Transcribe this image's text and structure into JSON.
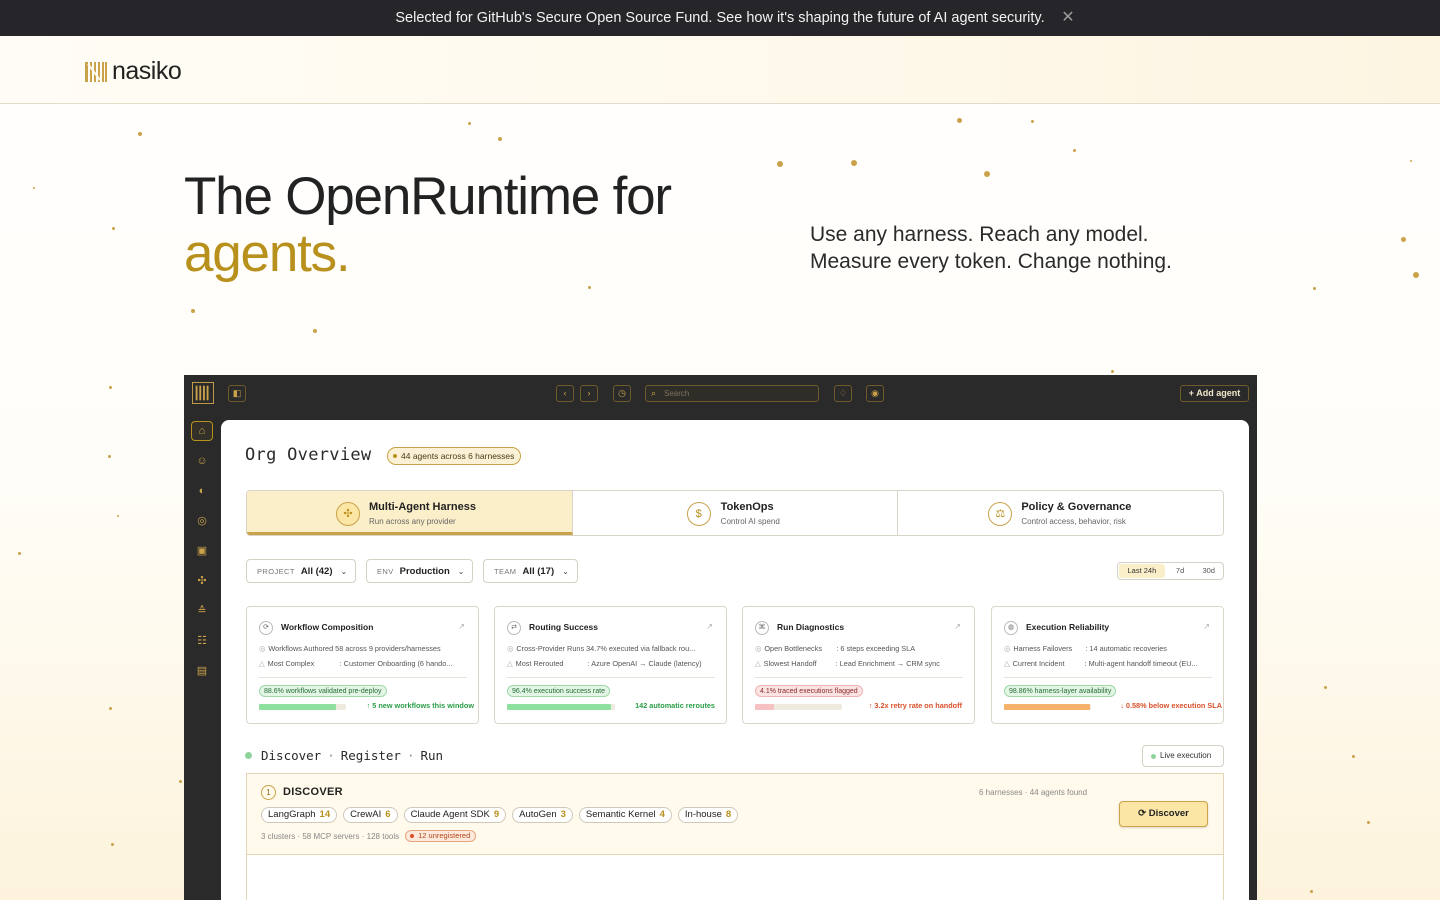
{
  "announcement": {
    "text": "Selected for GitHub's Secure Open Source Fund. See how it's shaping the future of AI agent security.",
    "close_icon": "close-icon"
  },
  "brand": {
    "name": "nasiko",
    "accent_color": "#c9a24a"
  },
  "hero": {
    "title_line1": "The OpenRuntime for",
    "title_line2": "agents.",
    "subtitle_line1": "Use any harness. Reach any model.",
    "subtitle_line2": "Measure every token. Change nothing."
  },
  "app": {
    "search_placeholder": "Search",
    "add_agent_label": "Add agent",
    "toolbar_icons": [
      "sidebar-toggle-icon",
      "back-icon",
      "forward-icon",
      "history-icon",
      "bell-icon",
      "settings-icon"
    ],
    "side_nav_icons": [
      "home-icon",
      "agent-icon",
      "brain-icon",
      "target-icon",
      "token-icon",
      "puzzle-icon",
      "stack-icon",
      "users-icon",
      "database-icon"
    ],
    "org_title": "Org Overview",
    "org_badge": "44 agents across 6 harnesses",
    "tabs": [
      {
        "title": "Multi-Agent Harness",
        "desc": "Run across any provider",
        "icon": "puzzle-icon",
        "active": true
      },
      {
        "title": "TokenOps",
        "desc": "Control AI spend",
        "icon": "token-icon",
        "active": false
      },
      {
        "title": "Policy & Governance",
        "desc": "Control access, behavior, risk",
        "icon": "scale-icon",
        "active": false
      }
    ],
    "filters": [
      {
        "key": "PROJECT",
        "value": "All (42)"
      },
      {
        "key": "ENV",
        "value": "Production"
      },
      {
        "key": "TEAM",
        "value": "All (17)"
      }
    ],
    "time_range": {
      "options": [
        "Last 24h",
        "7d",
        "30d"
      ],
      "selected": "Last 24h"
    },
    "cards": [
      {
        "title": "Workflow Composition",
        "row1_key": "Workflows Authored",
        "row1_val": "58 across 9 providers/harnesses",
        "row2_key": "Most Complex",
        "row2_val": ": Customer Onboarding (6 hando...",
        "pill": "88.6% workflows validated pre-deploy",
        "pill_kind": "green",
        "bar_fraction": 0.886,
        "bar_color": "#8ee0a0",
        "delta": "↑ 5 new workflows this window",
        "delta_kind": "up"
      },
      {
        "title": "Routing Success",
        "row1_key": "Cross-Provider Runs",
        "row1_val": "34.7% executed via fallback rou...",
        "row2_key": "Most Rerouted",
        "row2_val": ": Azure OpenAI → Claude (latency)",
        "pill": "96.4% execution success rate",
        "pill_kind": "green",
        "bar_fraction": 0.964,
        "bar_color": "#8ee0a0",
        "delta": "142 automatic reroutes",
        "delta_kind": "up"
      },
      {
        "title": "Run Diagnostics",
        "row1_key": "Open Bottlenecks",
        "row1_val": ": 6 steps exceeding SLA",
        "row2_key": "Slowest Handoff",
        "row2_val": ": Lead Enrichment → CRM sync",
        "pill": "4.1% traced executions flagged",
        "pill_kind": "red",
        "bar_fraction": 0.22,
        "bar_color": "#f6c1c1",
        "delta": "↑ 3.2x retry rate on handoff",
        "delta_kind": "down"
      },
      {
        "title": "Execution Reliability",
        "row1_key": "Harness Failovers",
        "row1_val": ": 14 automatic recoveries",
        "row2_key": "Current Incident",
        "row2_val": ": Multi-agent handoff timeout (EU...",
        "pill": "98.86% harness-layer availability",
        "pill_kind": "green",
        "bar_fraction": 0.9886,
        "bar_color": "#f6b26b",
        "delta": "↓ 0.58% below execution SLA",
        "delta_kind": "down"
      }
    ],
    "flow": {
      "step1": "Discover",
      "step2": "Register",
      "step3": "Run",
      "sep": "·",
      "live_label": "Live execution"
    },
    "discover": {
      "num": "1",
      "title": "DISCOVER",
      "found": "6 harnesses · 44 agents found",
      "button": "Discover",
      "chips": [
        {
          "name": "LangGraph",
          "count": "14"
        },
        {
          "name": "CrewAI",
          "count": "6"
        },
        {
          "name": "Claude Agent SDK",
          "count": "9"
        },
        {
          "name": "AutoGen",
          "count": "3"
        },
        {
          "name": "Semantic Kernel",
          "count": "4"
        },
        {
          "name": "In-house",
          "count": "8"
        }
      ],
      "meta": "3 clusters · 58 MCP servers · 128 tools",
      "unregistered": "12 unregistered"
    }
  }
}
